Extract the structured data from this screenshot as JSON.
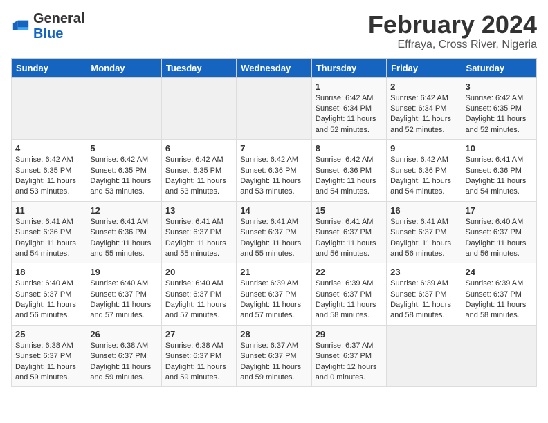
{
  "logo": {
    "general": "General",
    "blue": "Blue"
  },
  "title": "February 2024",
  "subtitle": "Effraya, Cross River, Nigeria",
  "days_of_week": [
    "Sunday",
    "Monday",
    "Tuesday",
    "Wednesday",
    "Thursday",
    "Friday",
    "Saturday"
  ],
  "weeks": [
    [
      {
        "day": "",
        "info": ""
      },
      {
        "day": "",
        "info": ""
      },
      {
        "day": "",
        "info": ""
      },
      {
        "day": "",
        "info": ""
      },
      {
        "day": "1",
        "info": "Sunrise: 6:42 AM\nSunset: 6:34 PM\nDaylight: 11 hours and 52 minutes."
      },
      {
        "day": "2",
        "info": "Sunrise: 6:42 AM\nSunset: 6:34 PM\nDaylight: 11 hours and 52 minutes."
      },
      {
        "day": "3",
        "info": "Sunrise: 6:42 AM\nSunset: 6:35 PM\nDaylight: 11 hours and 52 minutes."
      }
    ],
    [
      {
        "day": "4",
        "info": "Sunrise: 6:42 AM\nSunset: 6:35 PM\nDaylight: 11 hours and 53 minutes."
      },
      {
        "day": "5",
        "info": "Sunrise: 6:42 AM\nSunset: 6:35 PM\nDaylight: 11 hours and 53 minutes."
      },
      {
        "day": "6",
        "info": "Sunrise: 6:42 AM\nSunset: 6:35 PM\nDaylight: 11 hours and 53 minutes."
      },
      {
        "day": "7",
        "info": "Sunrise: 6:42 AM\nSunset: 6:36 PM\nDaylight: 11 hours and 53 minutes."
      },
      {
        "day": "8",
        "info": "Sunrise: 6:42 AM\nSunset: 6:36 PM\nDaylight: 11 hours and 54 minutes."
      },
      {
        "day": "9",
        "info": "Sunrise: 6:42 AM\nSunset: 6:36 PM\nDaylight: 11 hours and 54 minutes."
      },
      {
        "day": "10",
        "info": "Sunrise: 6:41 AM\nSunset: 6:36 PM\nDaylight: 11 hours and 54 minutes."
      }
    ],
    [
      {
        "day": "11",
        "info": "Sunrise: 6:41 AM\nSunset: 6:36 PM\nDaylight: 11 hours and 54 minutes."
      },
      {
        "day": "12",
        "info": "Sunrise: 6:41 AM\nSunset: 6:36 PM\nDaylight: 11 hours and 55 minutes."
      },
      {
        "day": "13",
        "info": "Sunrise: 6:41 AM\nSunset: 6:37 PM\nDaylight: 11 hours and 55 minutes."
      },
      {
        "day": "14",
        "info": "Sunrise: 6:41 AM\nSunset: 6:37 PM\nDaylight: 11 hours and 55 minutes."
      },
      {
        "day": "15",
        "info": "Sunrise: 6:41 AM\nSunset: 6:37 PM\nDaylight: 11 hours and 56 minutes."
      },
      {
        "day": "16",
        "info": "Sunrise: 6:41 AM\nSunset: 6:37 PM\nDaylight: 11 hours and 56 minutes."
      },
      {
        "day": "17",
        "info": "Sunrise: 6:40 AM\nSunset: 6:37 PM\nDaylight: 11 hours and 56 minutes."
      }
    ],
    [
      {
        "day": "18",
        "info": "Sunrise: 6:40 AM\nSunset: 6:37 PM\nDaylight: 11 hours and 56 minutes."
      },
      {
        "day": "19",
        "info": "Sunrise: 6:40 AM\nSunset: 6:37 PM\nDaylight: 11 hours and 57 minutes."
      },
      {
        "day": "20",
        "info": "Sunrise: 6:40 AM\nSunset: 6:37 PM\nDaylight: 11 hours and 57 minutes."
      },
      {
        "day": "21",
        "info": "Sunrise: 6:39 AM\nSunset: 6:37 PM\nDaylight: 11 hours and 57 minutes."
      },
      {
        "day": "22",
        "info": "Sunrise: 6:39 AM\nSunset: 6:37 PM\nDaylight: 11 hours and 58 minutes."
      },
      {
        "day": "23",
        "info": "Sunrise: 6:39 AM\nSunset: 6:37 PM\nDaylight: 11 hours and 58 minutes."
      },
      {
        "day": "24",
        "info": "Sunrise: 6:39 AM\nSunset: 6:37 PM\nDaylight: 11 hours and 58 minutes."
      }
    ],
    [
      {
        "day": "25",
        "info": "Sunrise: 6:38 AM\nSunset: 6:37 PM\nDaylight: 11 hours and 59 minutes."
      },
      {
        "day": "26",
        "info": "Sunrise: 6:38 AM\nSunset: 6:37 PM\nDaylight: 11 hours and 59 minutes."
      },
      {
        "day": "27",
        "info": "Sunrise: 6:38 AM\nSunset: 6:37 PM\nDaylight: 11 hours and 59 minutes."
      },
      {
        "day": "28",
        "info": "Sunrise: 6:37 AM\nSunset: 6:37 PM\nDaylight: 11 hours and 59 minutes."
      },
      {
        "day": "29",
        "info": "Sunrise: 6:37 AM\nSunset: 6:37 PM\nDaylight: 12 hours and 0 minutes."
      },
      {
        "day": "",
        "info": ""
      },
      {
        "day": "",
        "info": ""
      }
    ]
  ]
}
